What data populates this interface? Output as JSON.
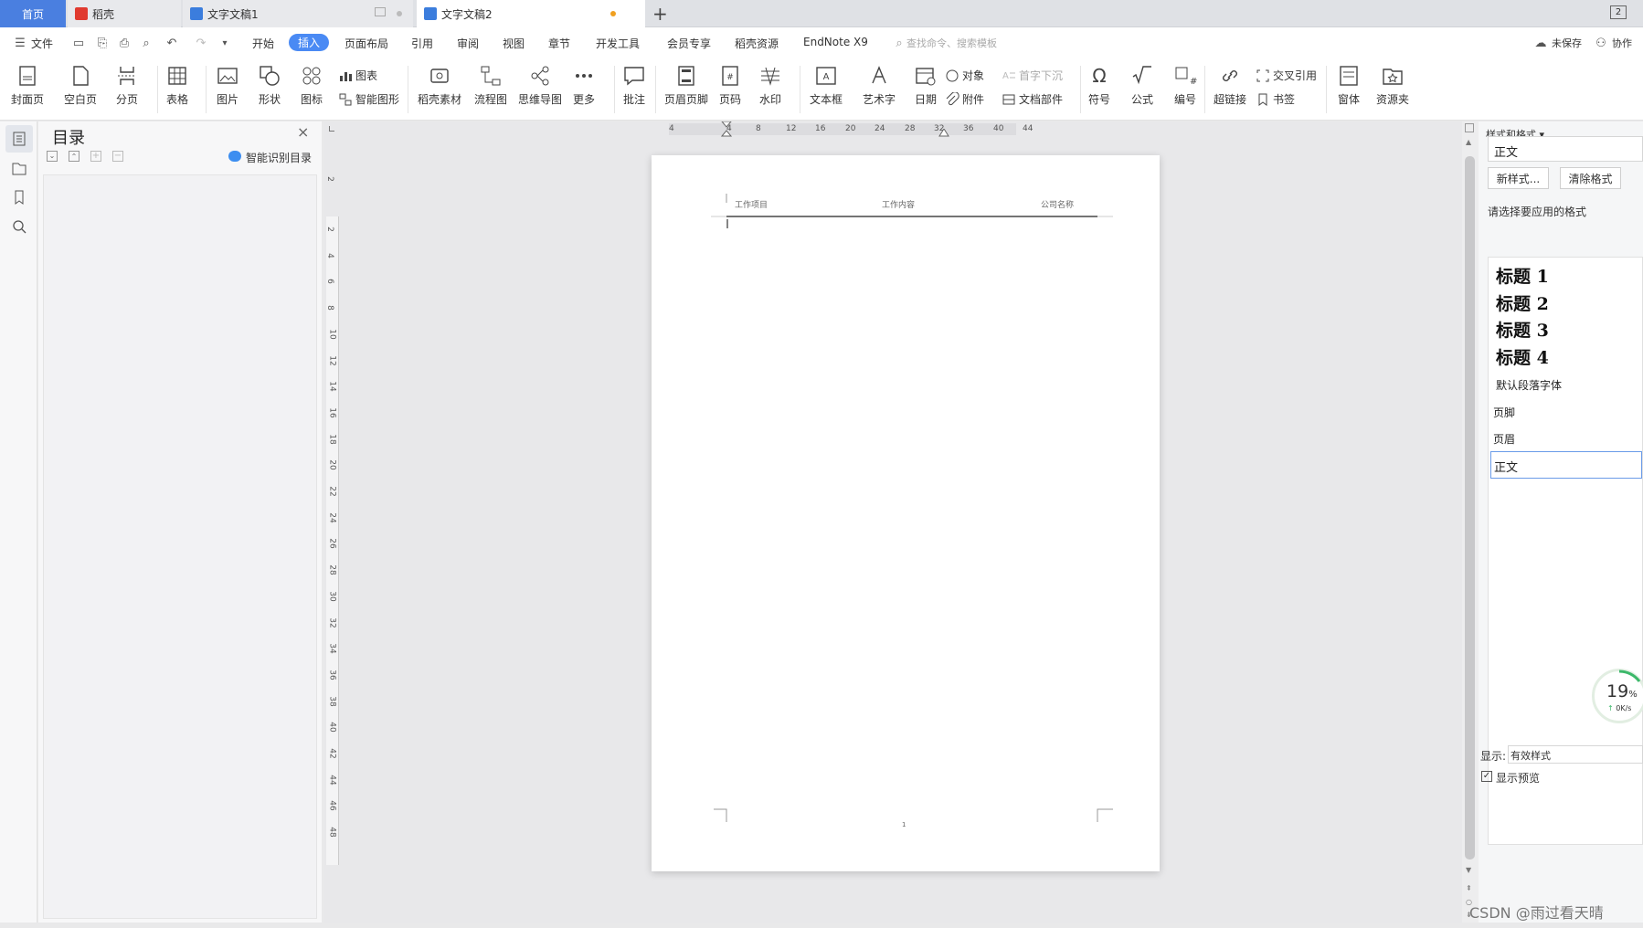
{
  "tabs": {
    "home": "首页",
    "daoke": "稻壳",
    "doc1": "文字文稿1",
    "doc2": "文字文稿2",
    "add": "+",
    "window_count": "2"
  },
  "menu": {
    "file": "文件",
    "items": [
      "开始",
      "插入",
      "页面布局",
      "引用",
      "审阅",
      "视图",
      "章节",
      "开发工具",
      "会员专享",
      "稻壳资源",
      "EndNote X9"
    ],
    "search_placeholder": "查找命令、搜索模板",
    "unsaved": "未保存",
    "collab": "协作"
  },
  "ribbon": {
    "cover": "封面页",
    "blank": "空白页",
    "pagebreak": "分页",
    "table": "表格",
    "picture": "图片",
    "shape": "形状",
    "icon": "图标",
    "chart": "图表",
    "smartart": "智能图形",
    "daoke_material": "稻壳素材",
    "flowchart": "流程图",
    "mindmap": "思维导图",
    "more": "更多",
    "comment": "批注",
    "header_footer": "页眉页脚",
    "page_number": "页码",
    "watermark": "水印",
    "textbox": "文本框",
    "wordart": "艺术字",
    "date": "日期",
    "object": "对象",
    "attachment": "附件",
    "dropcap": "首字下沉",
    "doc_parts": "文档部件",
    "symbol": "符号",
    "formula": "公式",
    "numbering": "编号",
    "hyperlink": "超链接",
    "cross_ref": "交叉引用",
    "bookmark": "书签",
    "window": "窗体",
    "resource": "资源夹"
  },
  "toc": {
    "title": "目录",
    "smart": "智能识别目录"
  },
  "ruler": {
    "h": [
      "4",
      "4",
      "8",
      "12",
      "16",
      "20",
      "24",
      "28",
      "32",
      "36",
      "40",
      "44"
    ],
    "v": [
      "2",
      "2",
      "4",
      "6",
      "8",
      "10",
      "12",
      "14",
      "16",
      "18",
      "20",
      "22",
      "24",
      "26",
      "28",
      "30",
      "32",
      "34",
      "36",
      "38",
      "40",
      "42",
      "44",
      "46",
      "48"
    ]
  },
  "page": {
    "header_left": "工作项目",
    "header_mid": "工作内容",
    "header_right": "公司名称",
    "page_no": "1"
  },
  "styles": {
    "panel_title": "样式和格式",
    "current": "正文",
    "new_style": "新样式...",
    "clear_format": "清除格式",
    "prompt": "请选择要应用的格式",
    "list": [
      "标题 1",
      "标题 2",
      "标题 3",
      "标题 4",
      "默认段落字体",
      "页脚",
      "页眉",
      "正文"
    ],
    "show_label": "显示:",
    "show_value": "有效样式",
    "preview_label": "显示预览"
  },
  "speed": {
    "percent": "19",
    "unit": "%",
    "rate": "0K/s"
  },
  "watermark": "CSDN @雨过看天晴",
  "colors": {
    "accent": "#4a8af4",
    "home_tab": "#4a7fe0",
    "daoke_red": "#e03a2f"
  }
}
